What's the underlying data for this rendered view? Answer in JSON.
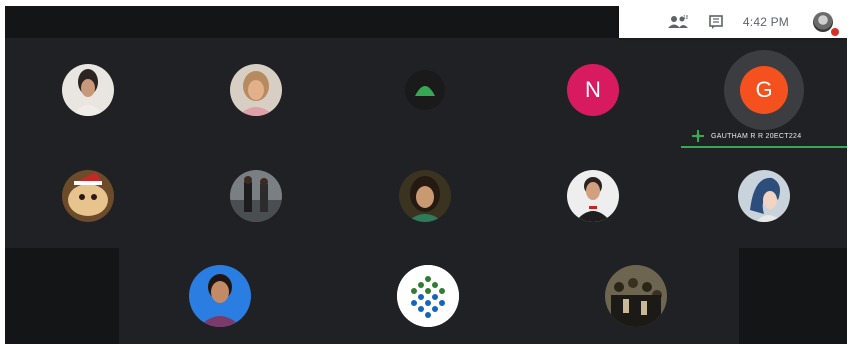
{
  "topbar": {
    "people_icon": "people-icon",
    "chat_icon": "chat-icon",
    "time": "4:42 PM"
  },
  "participants": {
    "tile_n": {
      "initial": "N",
      "color": "#d81b60"
    },
    "tile_g": {
      "initial": "G",
      "color": "#f4511e",
      "label": "GAUTHAM R R 20ECT224"
    }
  },
  "colors": {
    "speaking": "#34a853",
    "grid_bg": "#202124"
  }
}
